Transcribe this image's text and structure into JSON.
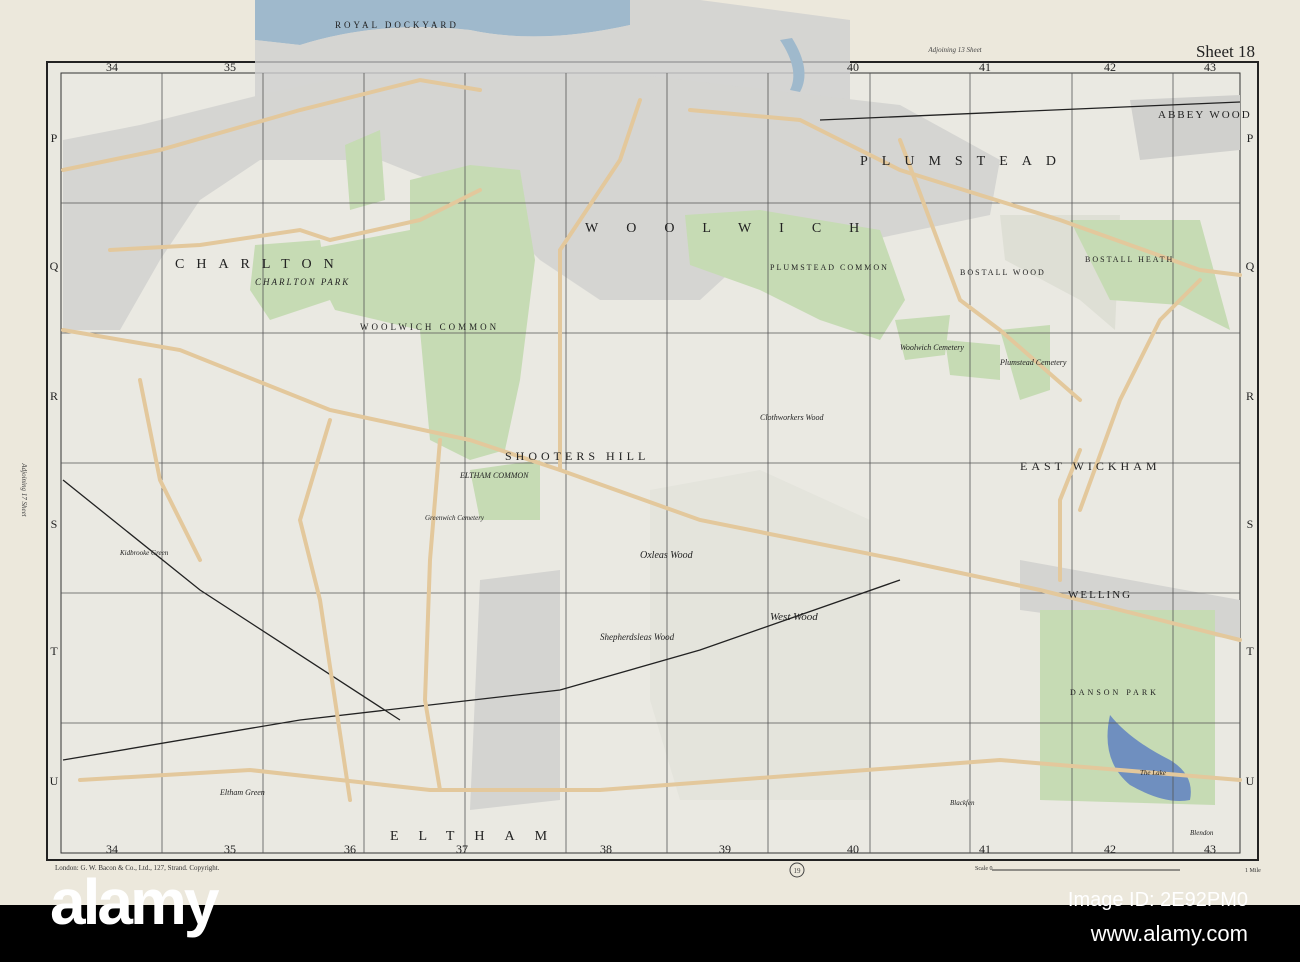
{
  "sheet": {
    "title": "Sheet 18",
    "adjoining_top": "Adjoining 13 Sheet",
    "adjoining_top_number": "13",
    "adjoining_left": "Adjoining 17 Sheet",
    "adjoining_left_number": "17",
    "adjoining_bottom_number": "19"
  },
  "grid": {
    "columns": [
      "34",
      "35",
      "36",
      "37",
      "38",
      "39",
      "40",
      "41",
      "42",
      "43"
    ],
    "rows": [
      "P",
      "Q",
      "R",
      "S",
      "T",
      "U"
    ]
  },
  "places": [
    {
      "name": "ROYAL DOCKYARD"
    },
    {
      "name": "CHARLTON"
    },
    {
      "name": "CHARLTON PARK"
    },
    {
      "name": "WOOLWICH"
    },
    {
      "name": "WOOLWICH COMMON"
    },
    {
      "name": "PLUMSTEAD"
    },
    {
      "name": "PLUMSTEAD COMMON"
    },
    {
      "name": "ABBEY WOOD"
    },
    {
      "name": "BOSTALL WOOD"
    },
    {
      "name": "BOSTALL HEATH"
    },
    {
      "name": "Woolwich Cemetery"
    },
    {
      "name": "Plumstead Cemetery"
    },
    {
      "name": "SHOOTERS HILL"
    },
    {
      "name": "ELTHAM COMMON"
    },
    {
      "name": "EAST WICKHAM"
    },
    {
      "name": "Clothworkers Wood"
    },
    {
      "name": "Oxleas Wood"
    },
    {
      "name": "Shepherdsleas Wood"
    },
    {
      "name": "West Wood"
    },
    {
      "name": "WELLING"
    },
    {
      "name": "DANSON PARK"
    },
    {
      "name": "The Lake"
    },
    {
      "name": "ELTHAM"
    },
    {
      "name": "Eltham Green"
    },
    {
      "name": "Greenwich Cemetery"
    },
    {
      "name": "Kidbrooke Green"
    },
    {
      "name": "Blackfen"
    },
    {
      "name": "Blendon"
    }
  ],
  "footer": {
    "publisher": "London: G. W. Bacon & Co., Ltd., 127, Strand.  Copyright.",
    "scale_label": "Scale 0",
    "scale_end": "1 Mile"
  },
  "stock": {
    "logo": "alamy",
    "image_id": "Image ID: 2E92PM0",
    "site": "www.alamy.com"
  },
  "colors": {
    "paper": "#ece8dc",
    "park": "#c6dbb4",
    "road": "#e3c89c",
    "water": "#9fb9cc",
    "lake": "#6f8fbf"
  }
}
